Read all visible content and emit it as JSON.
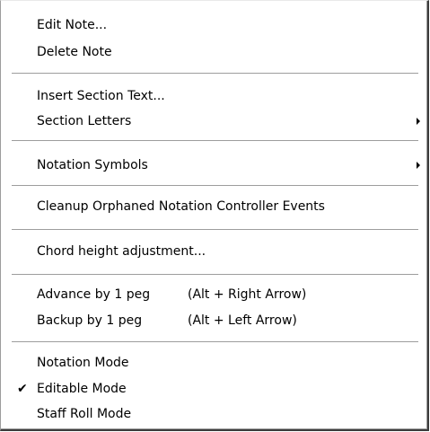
{
  "menu": {
    "items": [
      {
        "label": "Edit Note..."
      },
      {
        "label": "Delete Note"
      },
      {
        "label": "Insert Section Text..."
      },
      {
        "label": "Section Letters",
        "submenu": true
      },
      {
        "label": "Notation Symbols",
        "submenu": true
      },
      {
        "label": "Cleanup Orphaned Notation Controller Events"
      },
      {
        "label": "Chord height adjustment..."
      },
      {
        "label": "Advance by 1 peg",
        "accelerator": "(Alt + Right Arrow)"
      },
      {
        "label": "Backup by 1 peg",
        "accelerator": "(Alt + Left Arrow)"
      },
      {
        "label": "Notation Mode"
      },
      {
        "label": "Editable Mode",
        "checked": true,
        "check_glyph": "✔"
      },
      {
        "label": "Staff Roll Mode"
      }
    ]
  }
}
